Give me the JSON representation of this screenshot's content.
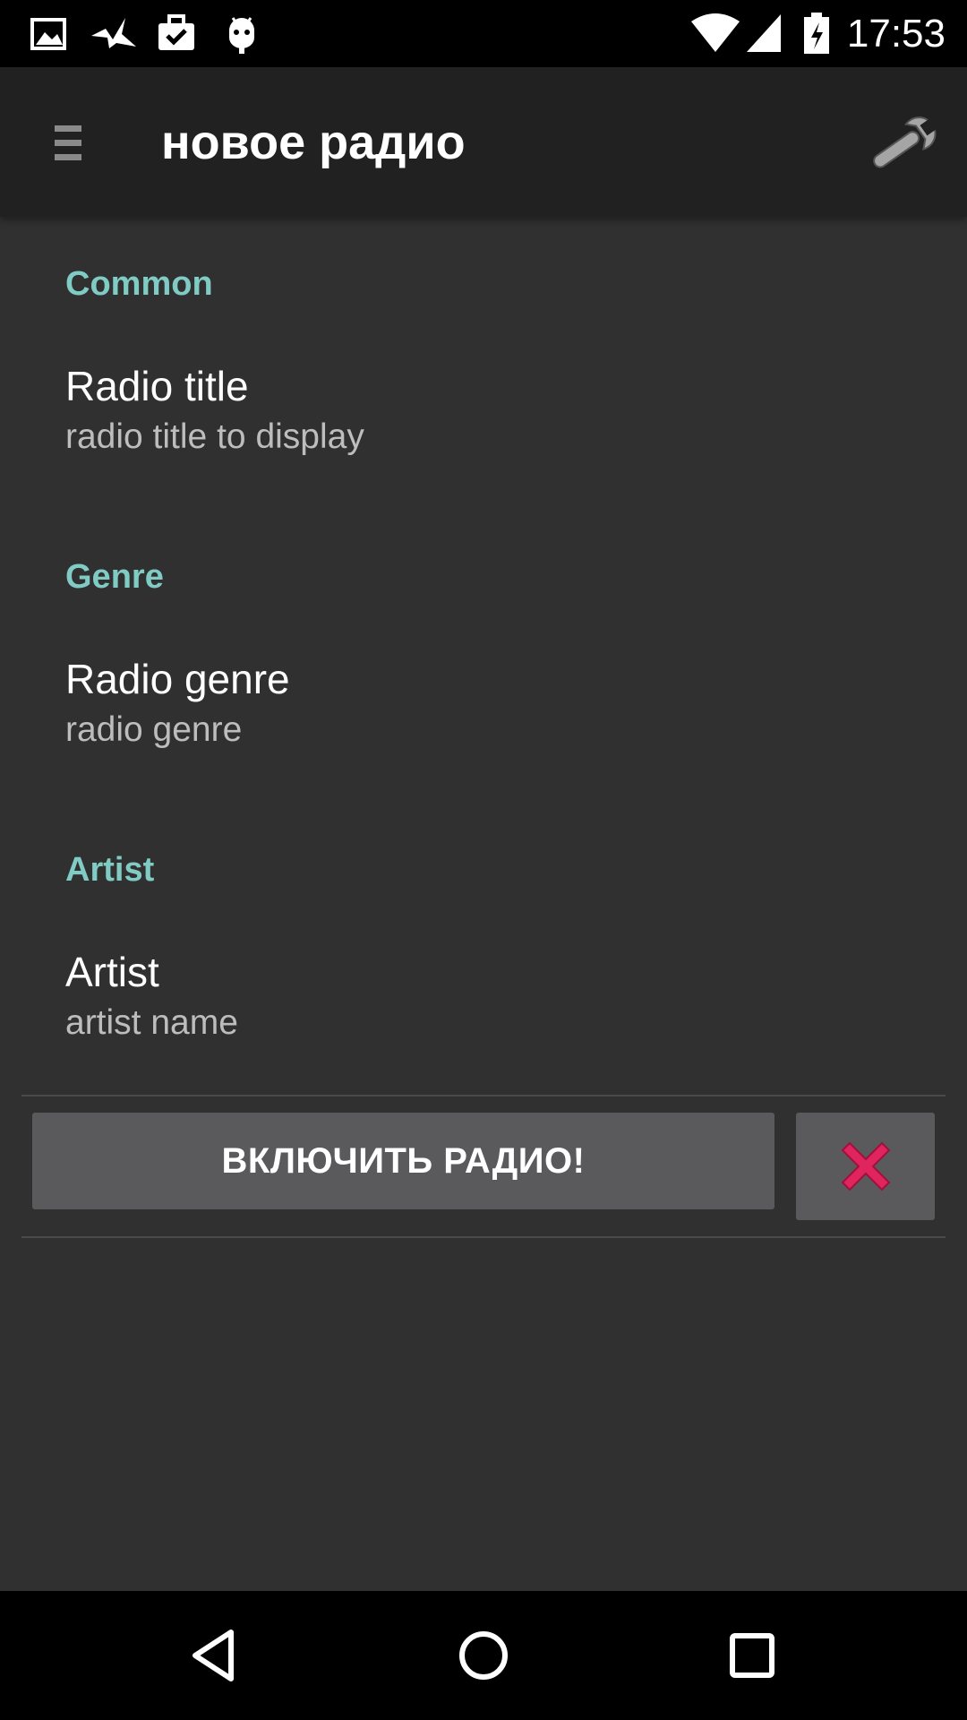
{
  "status_bar": {
    "time": "17:53",
    "left_icons": [
      "image-icon",
      "bird-icon",
      "briefcase-check-icon",
      "android-icon"
    ],
    "right_icons": [
      "wifi-icon",
      "cell-signal-icon",
      "battery-charging-icon"
    ]
  },
  "app_bar": {
    "title": "новое радио",
    "menu_icon": "hamburger-menu-icon",
    "action_icon": "wrench-icon"
  },
  "sections": [
    {
      "header": "Common",
      "item_title": "Radio title",
      "item_summary": "radio title to display"
    },
    {
      "header": "Genre",
      "item_title": "Radio genre",
      "item_summary": "radio genre"
    },
    {
      "header": "Artist",
      "item_title": "Artist",
      "item_summary": "artist name"
    }
  ],
  "actions": {
    "play_label": "ВКЛЮЧИТЬ РАДИО!",
    "close_icon": "close-x-icon"
  },
  "nav_bar": {
    "buttons": [
      "back-triangle-icon",
      "home-circle-icon",
      "recents-square-icon"
    ]
  },
  "colors": {
    "background": "#303030",
    "app_bar": "#212121",
    "section_header": "#80cbc4",
    "button": "#5a5a5c",
    "close_x": "#e0245e"
  }
}
